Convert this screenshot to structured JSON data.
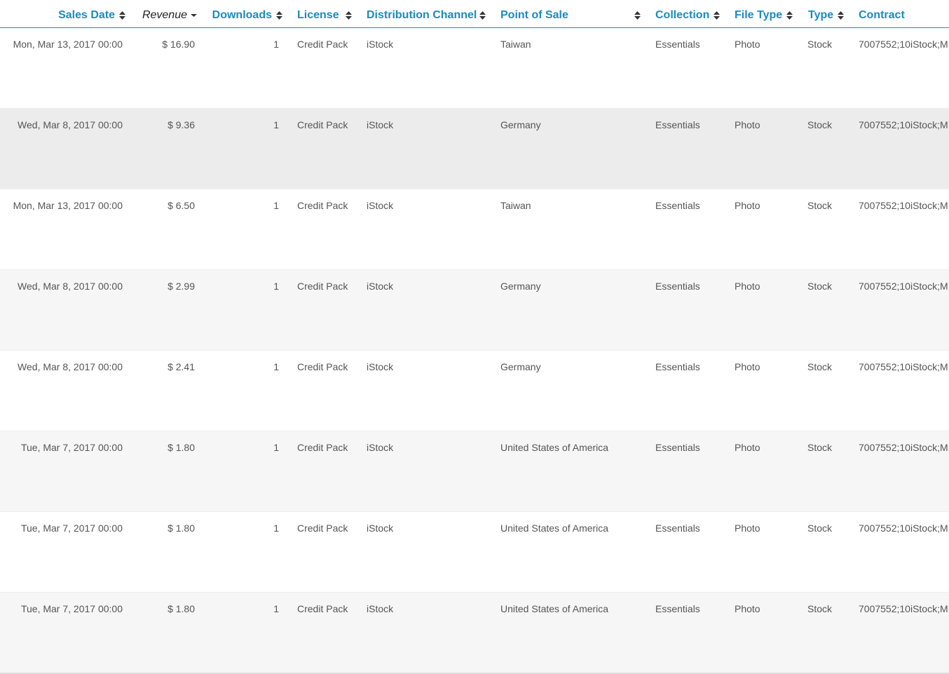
{
  "columns": {
    "sales_date": "Sales Date",
    "revenue": "Revenue",
    "downloads": "Downloads",
    "license": "License",
    "distribution_channel": "Distribution Channel",
    "point_of_sale": "Point of Sale",
    "collection": "Collection",
    "file_type": "File Type",
    "type": "Type",
    "contract": "Contract"
  },
  "active_sort_column": "revenue",
  "active_sort_direction": "descending",
  "rows": [
    {
      "date": "Mon, Mar 13, 2017 00:00",
      "revenue": "$ 16.90",
      "downloads": "1",
      "license": "Credit Pack",
      "channel": "iStock",
      "pos": "Taiwan",
      "collection": "Essentials",
      "file_type": "Photo",
      "type": "Stock",
      "contract": "7007552;10iStock;M"
    },
    {
      "date": "Wed, Mar 8, 2017 00:00",
      "revenue": "$ 9.36",
      "downloads": "1",
      "license": "Credit Pack",
      "channel": "iStock",
      "pos": "Germany",
      "collection": "Essentials",
      "file_type": "Photo",
      "type": "Stock",
      "contract": "7007552;10iStock;M"
    },
    {
      "date": "Mon, Mar 13, 2017 00:00",
      "revenue": "$ 6.50",
      "downloads": "1",
      "license": "Credit Pack",
      "channel": "iStock",
      "pos": "Taiwan",
      "collection": "Essentials",
      "file_type": "Photo",
      "type": "Stock",
      "contract": "7007552;10iStock;M"
    },
    {
      "date": "Wed, Mar 8, 2017 00:00",
      "revenue": "$ 2.99",
      "downloads": "1",
      "license": "Credit Pack",
      "channel": "iStock",
      "pos": "Germany",
      "collection": "Essentials",
      "file_type": "Photo",
      "type": "Stock",
      "contract": "7007552;10iStock;M"
    },
    {
      "date": "Wed, Mar 8, 2017 00:00",
      "revenue": "$ 2.41",
      "downloads": "1",
      "license": "Credit Pack",
      "channel": "iStock",
      "pos": "Germany",
      "collection": "Essentials",
      "file_type": "Photo",
      "type": "Stock",
      "contract": "7007552;10iStock;M"
    },
    {
      "date": "Tue, Mar 7, 2017 00:00",
      "revenue": "$ 1.80",
      "downloads": "1",
      "license": "Credit Pack",
      "channel": "iStock",
      "pos": "United States of America",
      "collection": "Essentials",
      "file_type": "Photo",
      "type": "Stock",
      "contract": "7007552;10iStock;M"
    },
    {
      "date": "Tue, Mar 7, 2017 00:00",
      "revenue": "$ 1.80",
      "downloads": "1",
      "license": "Credit Pack",
      "channel": "iStock",
      "pos": "United States of America",
      "collection": "Essentials",
      "file_type": "Photo",
      "type": "Stock",
      "contract": "7007552;10iStock;M"
    },
    {
      "date": "Tue, Mar 7, 2017 00:00",
      "revenue": "$ 1.80",
      "downloads": "1",
      "license": "Credit Pack",
      "channel": "iStock",
      "pos": "United States of America",
      "collection": "Essentials",
      "file_type": "Photo",
      "type": "Stock",
      "contract": "7007552;10iStock;M"
    }
  ],
  "colors": {
    "header_link": "#1b8bbf",
    "header_border": "#2a8bbf",
    "text": "#555555",
    "row_alt": "#f6f6f6",
    "row_hover": "#ececec"
  }
}
